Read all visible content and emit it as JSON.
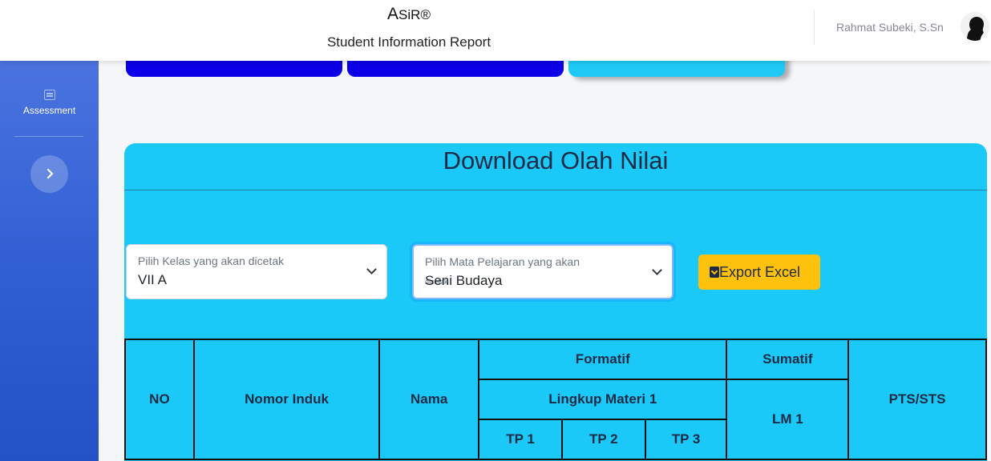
{
  "header": {
    "brand_big": "A",
    "brand_rest": "SiR®",
    "subtitle": "Student Information Report",
    "username": "Rahmat Subeki, S.Sn"
  },
  "sidebar": {
    "items": [
      {
        "label": "Assessment",
        "icon": "table-icon"
      }
    ],
    "toggle_icon": "chevron-right-icon"
  },
  "panel": {
    "title": "Download Olah Nilai",
    "class_select": {
      "label": "Pilih Kelas yang akan dicetak",
      "value": "VII A"
    },
    "subject_select": {
      "label": "Pilih Mata Pelajaran yang akan",
      "label_overflow": "dicetak",
      "value": "Seni Budaya"
    },
    "export_label": "Export Excel"
  },
  "table": {
    "headers": {
      "no": "NO",
      "nomor_induk": "Nomor Induk",
      "nama": "Nama",
      "formatif": "Formatif",
      "lingkup_materi": "Lingkup Materi 1",
      "tp": [
        "TP 1",
        "TP 2",
        "TP 3"
      ],
      "sumatif": "Sumatif",
      "lm": "LM 1",
      "pts_sts": "PTS/STS"
    }
  },
  "colors": {
    "sidebar": "#2f5ed3",
    "panel": "#1ac9f8",
    "export_button": "#fec20d",
    "card_blue": "#0b00e6"
  }
}
